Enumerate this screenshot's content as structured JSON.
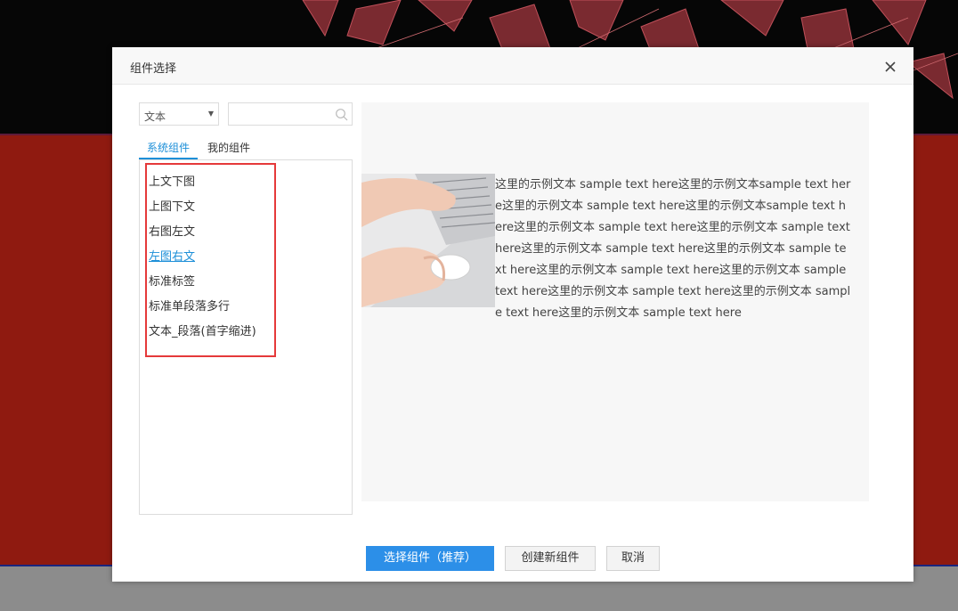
{
  "dialog": {
    "title": "组件选择",
    "close_icon": "close-icon"
  },
  "filter": {
    "type_value": "文本",
    "search_placeholder": "",
    "search_value": ""
  },
  "tabs": [
    {
      "label": "系统组件",
      "active": true
    },
    {
      "label": "我的组件",
      "active": false
    }
  ],
  "components": [
    {
      "label": "上文下图",
      "active": false
    },
    {
      "label": "上图下文",
      "active": false
    },
    {
      "label": "右图左文",
      "active": false
    },
    {
      "label": "左图右文",
      "active": true
    },
    {
      "label": "标准标签",
      "active": false
    },
    {
      "label": "标准单段落多行",
      "active": false
    },
    {
      "label": "文本_段落(首字缩进)",
      "active": false
    }
  ],
  "preview": {
    "image": "laptop-hand-photo",
    "text": "这里的示例文本 sample text here这里的示例文本sample text here这里的示例文本 sample text here这里的示例文本sample text here这里的示例文本 sample text here这里的示例文本 sample text here这里的示例文本 sample text here这里的示例文本 sample text here这里的示例文本 sample text here这里的示例文本 sample text here这里的示例文本 sample text here这里的示例文本 sample text here这里的示例文本 sample text here"
  },
  "buttons": {
    "select": "选择组件（推荐）",
    "create": "创建新组件",
    "cancel": "取消"
  },
  "colors": {
    "accent": "#1d8fd8",
    "primary_button": "#2c8fe8",
    "highlight": "#e5393a",
    "background_red": "#8f1a10"
  }
}
